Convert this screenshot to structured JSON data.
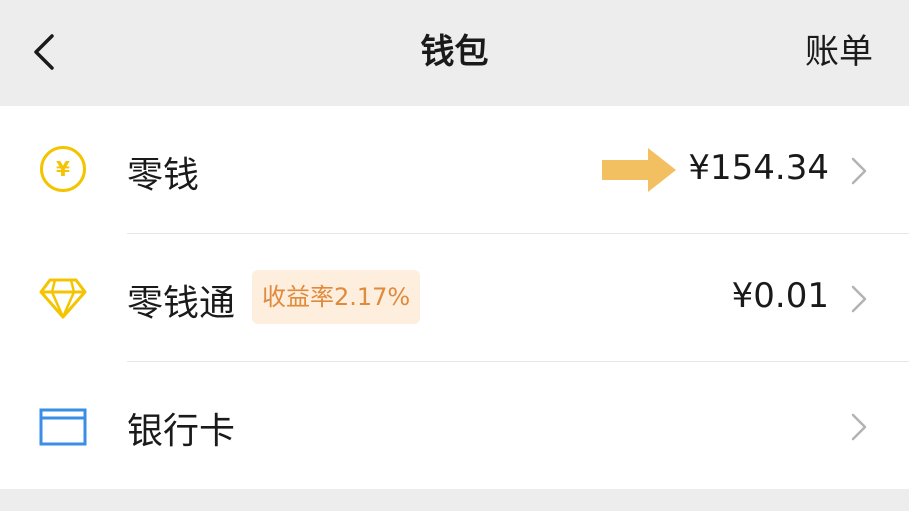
{
  "header": {
    "title": "钱包",
    "bill_label": "账单",
    "back_icon": "chevron-left-icon"
  },
  "wallet_items": [
    {
      "label": "零钱",
      "amount": "¥154.34",
      "icon": "yuan-coin-icon",
      "icon_color": "#f5c400"
    },
    {
      "label": "零钱通",
      "badge": "收益率2.17%",
      "amount": "¥0.01",
      "icon": "diamond-icon",
      "icon_color": "#f5c400"
    },
    {
      "label": "银行卡",
      "icon": "bank-card-icon",
      "icon_color": "#3a8ee6"
    }
  ],
  "annotation": {
    "arrow_color": "#f2c060"
  },
  "colors": {
    "header_bg": "#ededed",
    "list_bg": "#ffffff",
    "badge_text": "#e08a3c",
    "badge_bg": "#fdeedd",
    "chevron": "#b3b3b3"
  }
}
